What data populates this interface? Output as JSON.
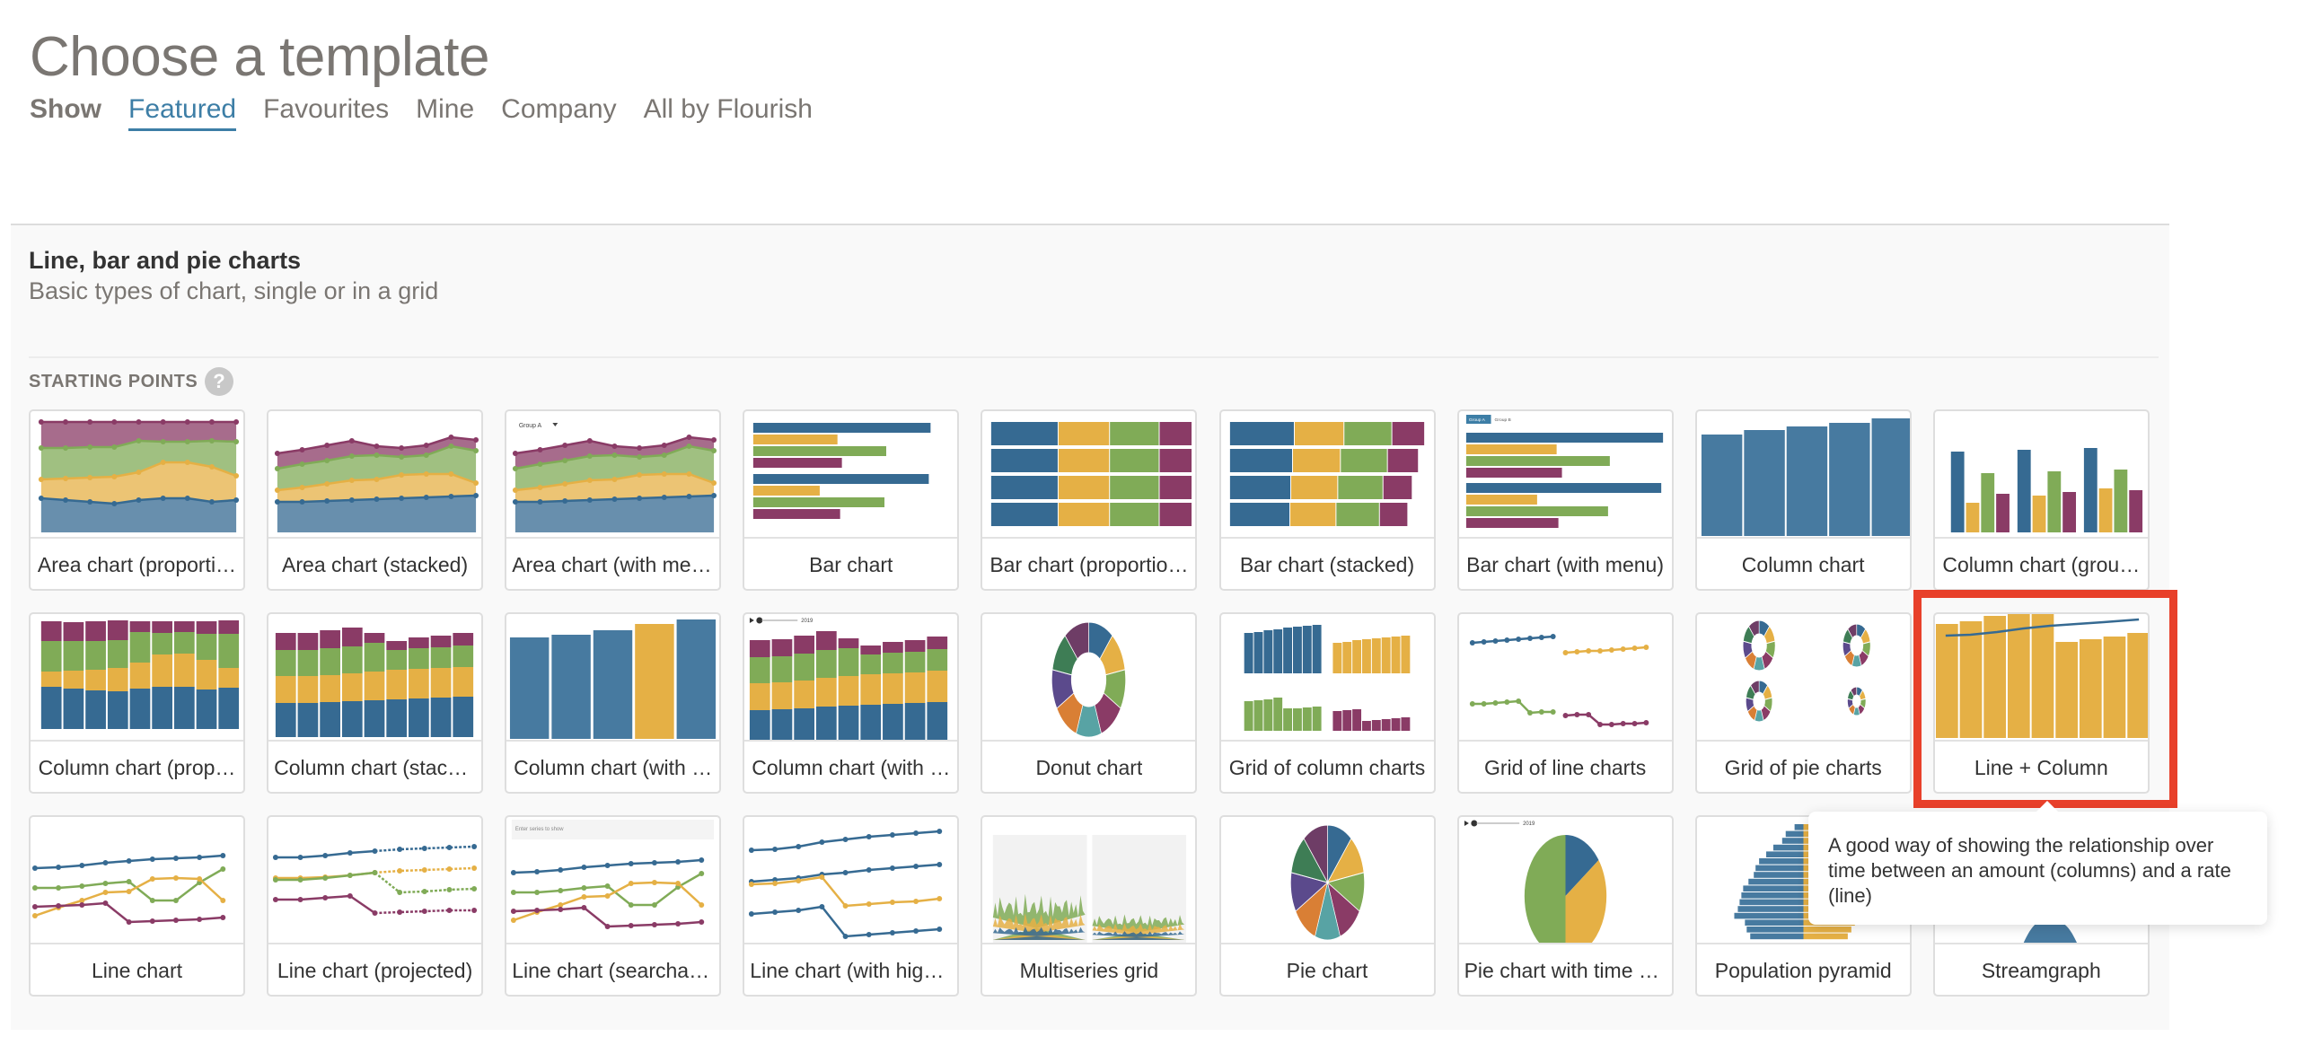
{
  "page": {
    "title": "Choose a template",
    "show_label": "Show",
    "tabs": [
      {
        "label": "Featured",
        "active": true
      },
      {
        "label": "Favourites",
        "active": false
      },
      {
        "label": "Mine",
        "active": false
      },
      {
        "label": "Company",
        "active": false
      },
      {
        "label": "All by Flourish",
        "active": false
      }
    ]
  },
  "section": {
    "title": "Line, bar and pie charts",
    "subtitle": "Basic types of chart, single or in a grid",
    "starting_points_label": "STARTING POINTS",
    "help_icon": "?"
  },
  "colors": {
    "blue": "#366a92",
    "yellow": "#e5b045",
    "green": "#80ab57",
    "purple": "#8a3b66",
    "accent": "#3d7ea6",
    "highlight": "#e8402a"
  },
  "templates": [
    {
      "label": "Area chart (proporti…",
      "thumb": "area-proportional"
    },
    {
      "label": "Area chart (stacked)",
      "thumb": "area-stacked"
    },
    {
      "label": "Area chart (with menu)",
      "thumb": "area-menu",
      "menu_text": "Group A"
    },
    {
      "label": "Bar chart",
      "thumb": "bar"
    },
    {
      "label": "Bar chart (proportio…",
      "thumb": "bar-proportional"
    },
    {
      "label": "Bar chart (stacked)",
      "thumb": "bar-stacked"
    },
    {
      "label": "Bar chart (with menu)",
      "thumb": "bar-menu",
      "menu_buttons": [
        "Group A",
        "Group B"
      ]
    },
    {
      "label": "Column chart",
      "thumb": "column"
    },
    {
      "label": "Column chart (grou…",
      "thumb": "column-grouped"
    },
    {
      "label": "Column chart (prop…",
      "thumb": "column-proportional"
    },
    {
      "label": "Column chart (stack…",
      "thumb": "column-stacked"
    },
    {
      "label": "Column chart (with …",
      "thumb": "column-highlight"
    },
    {
      "label": "Column chart (with …",
      "thumb": "column-time",
      "slider_year": "2019"
    },
    {
      "label": "Donut chart",
      "thumb": "donut"
    },
    {
      "label": "Grid of column charts",
      "thumb": "grid-column"
    },
    {
      "label": "Grid of line charts",
      "thumb": "grid-line"
    },
    {
      "label": "Grid of pie charts",
      "thumb": "grid-pie"
    },
    {
      "label": "Line + Column",
      "thumb": "line-column",
      "highlighted": true
    },
    {
      "label": "Line chart",
      "thumb": "line"
    },
    {
      "label": "Line chart (projected)",
      "thumb": "line-projected"
    },
    {
      "label": "Line chart (searchable)",
      "thumb": "line-search",
      "search_placeholder": "Enter series to show"
    },
    {
      "label": "Line chart (with high…",
      "thumb": "line-highlight"
    },
    {
      "label": "Multiseries grid",
      "thumb": "multiseries"
    },
    {
      "label": "Pie chart",
      "thumb": "pie"
    },
    {
      "label": "Pie chart with time s…",
      "thumb": "pie-time",
      "slider_year": "2019"
    },
    {
      "label": "Population pyramid",
      "thumb": "pyramid"
    },
    {
      "label": "Streamgraph",
      "thumb": "stream"
    }
  ],
  "tooltip": {
    "text": "A good way of showing the relationship over time between an amount (columns) and a rate (line)"
  }
}
